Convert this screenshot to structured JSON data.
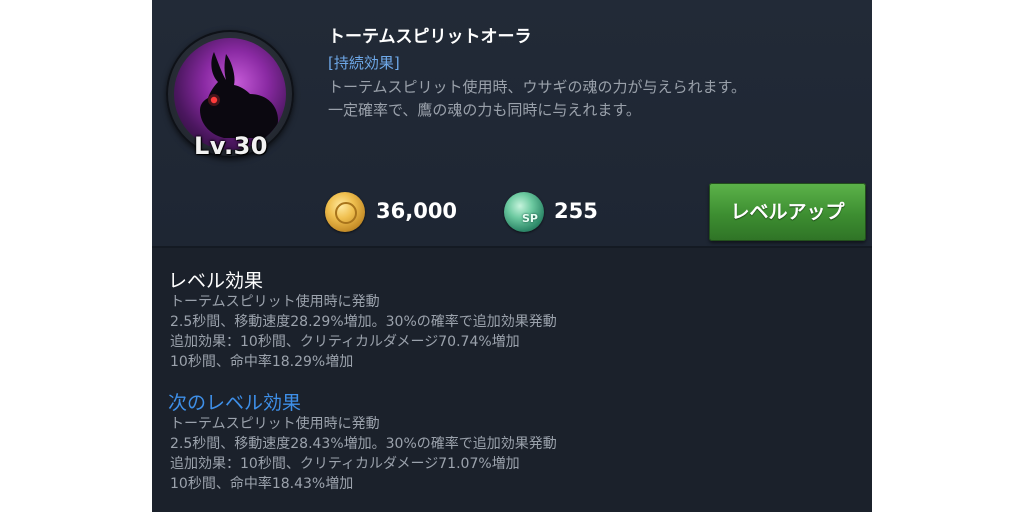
{
  "skill": {
    "level": "Lv.30",
    "name": "トーテムスピリットオーラ",
    "effect_tag": "[持続効果]",
    "description": [
      "トーテムスピリット使用時、ウサギの魂の力が与えられます。",
      "一定確率で、鷹の魂の力も同時に与えれます。"
    ],
    "icon": "rabbit-spirit-icon"
  },
  "cost": {
    "gold": "36,000",
    "gold_icon": "gold-coin-icon",
    "sp": "255",
    "sp_icon": "sp-coin-icon",
    "sp_icon_label": "SP"
  },
  "level_up_button": {
    "label": "レベルアップ",
    "color": "#3d8e31"
  },
  "current_effect": {
    "title": "レベル効果",
    "lines": [
      "トーテムスピリット使用時に発動",
      "2.5秒間、移動速度28.29%増加。30%の確率で追加効果発動",
      "追加効果：10秒間、クリティカルダメージ70.74%増加",
      "10秒間、命中率18.29%増加"
    ]
  },
  "next_effect": {
    "title": "次のレベル効果",
    "title_color": "#3e8fe8",
    "lines": [
      "トーテムスピリット使用時に発動",
      "2.5秒間、移動速度28.43%増加。30%の確率で追加効果発動",
      "追加効果：10秒間、クリティカルダメージ71.07%増加",
      "10秒間、命中率18.43%増加"
    ]
  }
}
